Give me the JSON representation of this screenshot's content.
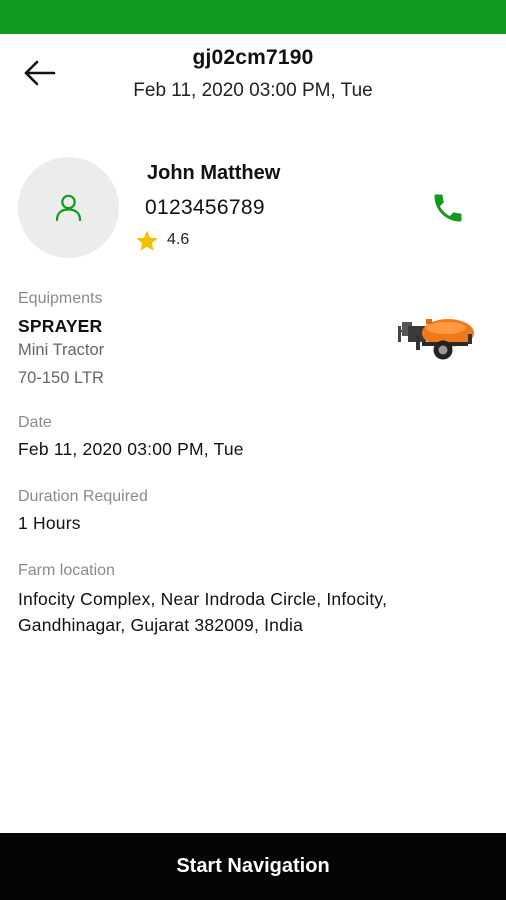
{
  "colors": {
    "status_bar": "#109a1f",
    "accent_green": "#109a1f",
    "star": "#f5c000",
    "nav_bar": "#050505"
  },
  "icons": {
    "back": "arrow-left-icon",
    "avatar": "user-icon",
    "rating": "star-icon",
    "call": "phone-icon",
    "equipment": "sprayer-image"
  },
  "header": {
    "vehicle_number": "gj02cm7190",
    "datetime": "Feb 11, 2020 03:00 PM, Tue"
  },
  "driver": {
    "name": "John Matthew",
    "phone": "0123456789",
    "rating": "4.6"
  },
  "equipment": {
    "label": "Equipments",
    "name": "SPRAYER",
    "type": "Mini Tractor",
    "capacity": "70-150 LTR"
  },
  "date": {
    "label": "Date",
    "value": "Feb 11, 2020 03:00 PM, Tue"
  },
  "duration": {
    "label": "Duration Required",
    "value": "1 Hours"
  },
  "location": {
    "label": "Farm location",
    "value": "Infocity Complex, Near Indroda Circle, Infocity, Gandhinagar, Gujarat 382009, India"
  },
  "footer": {
    "button_label": "Start Navigation"
  }
}
